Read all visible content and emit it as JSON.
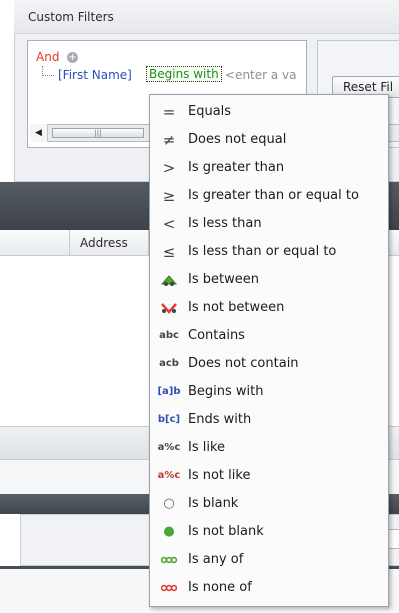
{
  "panel": {
    "title": "Custom Filters",
    "reset_button": "Reset Fil"
  },
  "filter_editor": {
    "group_operator": "And",
    "condition": {
      "field": "[First Name]",
      "operator": "Begins with",
      "value_placeholder": "<enter a va"
    }
  },
  "grid": {
    "column_header": "Address"
  },
  "menu": {
    "items": [
      {
        "icon": "equals-icon",
        "glyph": "=",
        "label": "Equals"
      },
      {
        "icon": "not-equal-icon",
        "glyph": "≠",
        "label": "Does not equal"
      },
      {
        "icon": "greater-than-icon",
        "glyph": ">",
        "label": "Is greater than"
      },
      {
        "icon": "greater-or-equal-icon",
        "glyph": "≥",
        "label": "Is greater than or equal to"
      },
      {
        "icon": "less-than-icon",
        "glyph": "<",
        "label": "Is less than"
      },
      {
        "icon": "less-or-equal-icon",
        "glyph": "≤",
        "label": "Is less than or equal to"
      },
      {
        "icon": "between-icon",
        "glyph": "",
        "label": "Is between"
      },
      {
        "icon": "not-between-icon",
        "glyph": "",
        "label": "Is not between"
      },
      {
        "icon": "contains-icon",
        "glyph": "abc",
        "label": "Contains"
      },
      {
        "icon": "not-contains-icon",
        "glyph": "acb",
        "label": "Does not contain"
      },
      {
        "icon": "begins-with-icon",
        "glyph": "[a]b",
        "label": "Begins with"
      },
      {
        "icon": "ends-with-icon",
        "glyph": "b[c]",
        "label": "Ends with"
      },
      {
        "icon": "like-icon",
        "glyph": "a%c",
        "label": "Is like"
      },
      {
        "icon": "not-like-icon",
        "glyph": "a%c",
        "label": "Is not like"
      },
      {
        "icon": "blank-icon",
        "glyph": "○",
        "label": "Is blank"
      },
      {
        "icon": "not-blank-icon",
        "glyph": "●",
        "label": "Is not blank"
      },
      {
        "icon": "any-of-icon",
        "glyph": "",
        "label": "Is any of"
      },
      {
        "icon": "none-of-icon",
        "glyph": "",
        "label": "Is none of"
      }
    ]
  },
  "colors": {
    "group_operator": "#e03b1f",
    "field": "#2c4fb6",
    "operator": "#218b1f",
    "placeholder": "#8f8f8f",
    "green_icon": "#4aa733",
    "red_icon": "#e0413a"
  }
}
